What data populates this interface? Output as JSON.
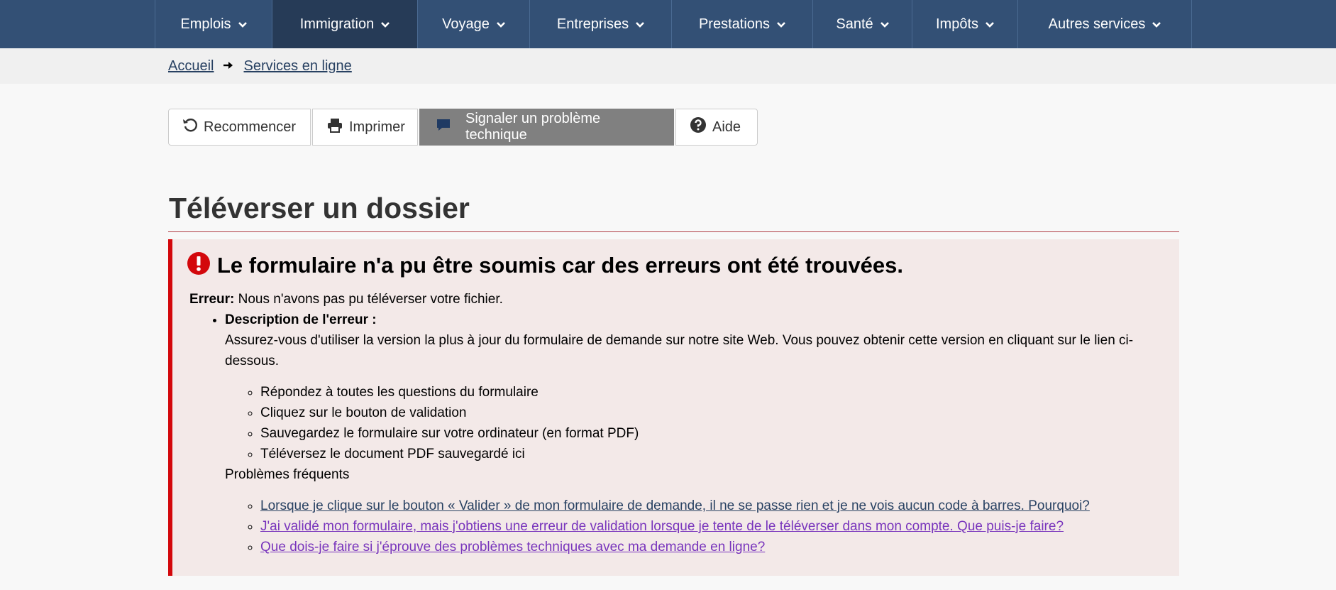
{
  "nav": {
    "items": [
      {
        "label": "Emplois",
        "active": false
      },
      {
        "label": "Immigration",
        "active": true
      },
      {
        "label": "Voyage",
        "active": false
      },
      {
        "label": "Entreprises",
        "active": false
      },
      {
        "label": "Prestations",
        "active": false
      },
      {
        "label": "Santé",
        "active": false
      },
      {
        "label": "Impôts",
        "active": false
      },
      {
        "label": "Autres services",
        "active": false
      }
    ]
  },
  "breadcrumb": {
    "home": "Accueil",
    "current": "Services en ligne"
  },
  "toolbar": {
    "restart": "Recommencer",
    "print": "Imprimer",
    "report": "Signaler un problème technique",
    "help": "Aide"
  },
  "page": {
    "title": "Téléverser un dossier"
  },
  "alert": {
    "heading": "Le formulaire n'a pu être soumis car des erreurs ont été trouvées.",
    "error_label": "Erreur:",
    "error_text": " Nous n'avons pas pu téléverser votre fichier.",
    "desc_label": "Description de l'erreur :",
    "desc_text": "Assurez-vous d'utiliser la version la plus à jour du formulaire de demande sur notre site Web. Vous pouvez obtenir cette version en cliquant sur le lien ci-dessous.",
    "steps": [
      "Répondez à toutes les questions du formulaire",
      "Cliquez sur le bouton de validation",
      "Sauvegardez le formulaire sur votre ordinateur (en format PDF)",
      "Téléversez le document PDF sauvegardé ici"
    ],
    "faq_label": "Problèmes fréquents",
    "faq_links": [
      "Lorsque je clique sur le bouton « Valider » de mon formulaire de demande, il ne se passe rien et je ne vois aucun code à barres. Pourquoi?",
      "J'ai validé mon formulaire, mais j'obtiens une erreur de validation lorsque je tente de le téléverser dans mon compte. Que puis-je faire?",
      "Que dois-je faire si j'éprouve des problèmes techniques avec ma demande en ligne?"
    ]
  },
  "colors": {
    "nav_bg": "#335075",
    "nav_active": "#263b57",
    "alert_border": "#d3080c",
    "alert_bg": "#f3e9e8",
    "link": "#284162",
    "visited_link": "#7834bc"
  }
}
